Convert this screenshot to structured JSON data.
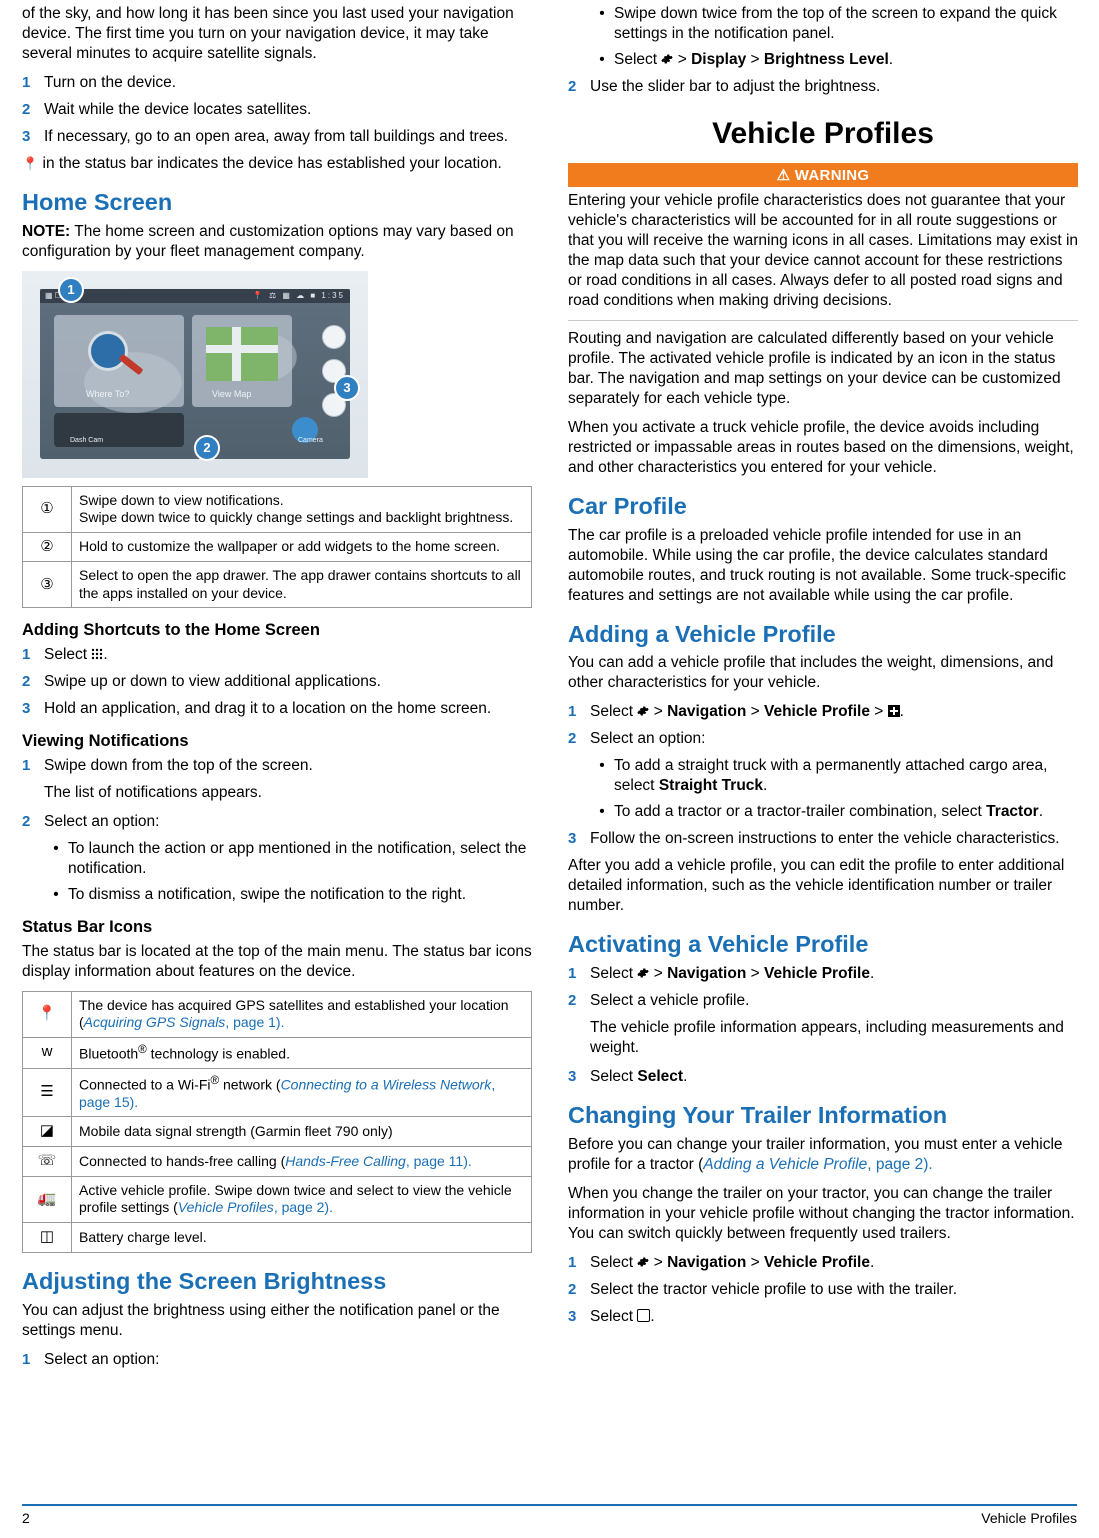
{
  "footer": {
    "page_number": "2",
    "section_title": "Vehicle Profiles"
  },
  "left_column": {
    "intro_paragraph": "of the sky, and how long it has been since you last used your navigation device. The first time you turn on your navigation device, it may take several minutes to acquire satellite signals.",
    "intro_steps": [
      {
        "num": "1",
        "text": "Turn on the device."
      },
      {
        "num": "2",
        "text": "Wait while the device locates satellites."
      },
      {
        "num": "3",
        "text": "If necessary, go to an open area, away from tall buildings and trees."
      }
    ],
    "status_note_icon": "location-pin-icon",
    "status_note": "in the status bar indicates the device has established your location.",
    "home_screen": {
      "heading": "Home Screen",
      "note_label": "NOTE:",
      "note_text": " The home screen and customization options may vary based on configuration by your fleet management company.",
      "device_image": {
        "status_time": "1:35",
        "tile_where_to": "Where To?",
        "tile_view_map": "View Map",
        "tile_dash_cam": "Dash Cam",
        "tile_camera": "Camera",
        "callouts": [
          "1",
          "2",
          "3"
        ]
      },
      "callout_table": [
        {
          "marker": "①",
          "text": "Swipe down to view notifications.\nSwipe down twice to quickly change settings and backlight brightness."
        },
        {
          "marker": "②",
          "text": "Hold to customize the wallpaper or add widgets to the home screen."
        },
        {
          "marker": "③",
          "text": "Select to open the app drawer. The app drawer contains shortcuts to all the apps installed on your device."
        }
      ]
    },
    "adding_shortcuts": {
      "heading": "Adding Shortcuts to the Home Screen",
      "steps": [
        {
          "num": "1",
          "text": "Select",
          "icon": "app-drawer-icon",
          "suffix": "."
        },
        {
          "num": "2",
          "text": "Swipe up or down to view additional applications."
        },
        {
          "num": "3",
          "text": "Hold an application, and drag it to a location on the home screen."
        }
      ]
    },
    "viewing_notifications": {
      "heading": "Viewing Notifications",
      "step1_num": "1",
      "step1_text": "Swipe down from the top of the screen.",
      "step1_result": "The list of notifications appears.",
      "step2_num": "2",
      "step2_text": "Select an option:",
      "bullets": [
        "To launch the action or app mentioned in the notification, select the notification.",
        "To dismiss a notification, swipe the notification to the right."
      ]
    },
    "status_bar_icons": {
      "heading": "Status Bar Icons",
      "intro": "The status bar is located at the top of the main menu. The status bar icons display information about features on the device.",
      "rows": [
        {
          "icon": "gps-pin-icon",
          "text_parts": [
            "The device has acquired GPS satellites and established your location (",
            "Acquiring GPS Signals",
            ", page 1)."
          ]
        },
        {
          "icon": "bluetooth-icon",
          "text_parts": [
            "Bluetooth",
            "®",
            " technology is enabled."
          ]
        },
        {
          "icon": "wifi-icon",
          "text_parts": [
            "Connected to a Wi-Fi",
            "®",
            " network (",
            "Connecting to a Wireless Network",
            ", page 15)."
          ]
        },
        {
          "icon": "cellular-signal-icon",
          "text_parts": [
            "Mobile data signal strength (Garmin fleet 790 only)"
          ]
        },
        {
          "icon": "phone-icon",
          "text_parts": [
            "Connected to hands-free calling (",
            "Hands-Free Calling",
            ", page 11)."
          ]
        },
        {
          "icon": "vehicle-profile-icon",
          "text_parts": [
            "Active vehicle profile. Swipe down twice and select to view the vehicle profile settings (",
            "Vehicle Profiles",
            ", page 2)."
          ]
        },
        {
          "icon": "battery-icon",
          "text_parts": [
            "Battery charge level."
          ]
        }
      ]
    },
    "brightness": {
      "heading": "Adjusting the Screen Brightness",
      "intro": "You can adjust the brightness using either the notification panel or the settings menu.",
      "step1_num": "1",
      "step1_text": "Select an option:"
    }
  },
  "right_column": {
    "brightness_cont": {
      "bullet1": "Swipe down twice from the top of the screen to expand the quick settings in the notification panel.",
      "bullet2_prefix": "Select ",
      "bullet2_icon": "gear-icon",
      "bullet2_mid": " > ",
      "bullet2_display": "Display",
      "bullet2_sep": " > ",
      "bullet2_brightness": "Brightness Level",
      "bullet2_suffix": ".",
      "step2_num": "2",
      "step2_text": "Use the slider bar to adjust the brightness."
    },
    "vehicle_profiles": {
      "title": "Vehicle Profiles",
      "warning_label": "WARNING",
      "warning_icon": "warning-triangle-icon",
      "warning_text": "Entering your vehicle profile characteristics does not guarantee that your vehicle's characteristics will be accounted for in all route suggestions or that you will receive the warning icons in all cases. Limitations may exist in the map data such that your device cannot account for these restrictions or road conditions in all cases. Always defer to all posted road signs and road conditions when making driving decisions.",
      "para1": "Routing and navigation are calculated differently based on your vehicle profile. The activated vehicle profile is indicated by an icon in the status bar. The navigation and map settings on your device can be customized separately for each vehicle type.",
      "para2": "When you activate a truck vehicle profile, the device avoids including restricted or impassable areas in routes based on the dimensions, weight, and other characteristics you entered for your vehicle."
    },
    "car_profile": {
      "heading": "Car Profile",
      "text": "The car profile is a preloaded vehicle profile intended for use in an automobile. While using the car profile, the device calculates standard automobile routes, and truck routing is not available. Some truck-specific features and settings are not available while using the car profile."
    },
    "adding_vehicle_profile": {
      "heading": "Adding a Vehicle Profile",
      "intro": "You can add a vehicle profile that includes the weight, dimensions, and other characteristics for your vehicle.",
      "step1_num": "1",
      "step1_prefix": "Select ",
      "step1_icon": "gear-icon",
      "step1_sep1": " > ",
      "step1_nav": "Navigation",
      "step1_sep2": " > ",
      "step1_profile": "Vehicle Profile",
      "step1_sep3": " > ",
      "step1_plus_icon": "plus-icon",
      "step1_suffix": ".",
      "step2_num": "2",
      "step2_text": "Select an option:",
      "bullets": [
        {
          "pre": "To add a straight truck with a permanently attached cargo area, select ",
          "bold": "Straight Truck",
          "post": "."
        },
        {
          "pre": "To add a tractor or a tractor-trailer combination, select ",
          "bold": "Tractor",
          "post": "."
        }
      ],
      "step3_num": "3",
      "step3_text": "Follow the on-screen instructions to enter the vehicle characteristics.",
      "after_text": "After you add a vehicle profile, you can edit the profile to enter additional detailed information, such as the vehicle identification number or trailer number."
    },
    "activating_vehicle_profile": {
      "heading": "Activating a Vehicle Profile",
      "step1_num": "1",
      "step1_prefix": "Select ",
      "step1_icon": "gear-icon",
      "step1_sep1": " > ",
      "step1_nav": "Navigation",
      "step1_sep2": " > ",
      "step1_profile": "Vehicle Profile",
      "step1_suffix": ".",
      "step2_num": "2",
      "step2_text": "Select a vehicle profile.",
      "step2_result": "The vehicle profile information appears, including measurements and weight.",
      "step3_num": "3",
      "step3_prefix": "Select ",
      "step3_bold": "Select",
      "step3_suffix": "."
    },
    "changing_trailer": {
      "heading": "Changing Your Trailer Information",
      "para1_pre": "Before you can change your trailer information, you must enter a vehicle profile for a tractor (",
      "para1_link": "Adding a Vehicle Profile",
      "para1_post": ", page 2).",
      "para2": "When you change the trailer on your tractor, you can change the trailer information in your vehicle profile without changing the tractor information. You can switch quickly between frequently used trailers.",
      "step1_num": "1",
      "step1_prefix": "Select ",
      "step1_icon": "gear-icon",
      "step1_sep1": " > ",
      "step1_nav": "Navigation",
      "step1_sep2": " > ",
      "step1_profile": "Vehicle Profile",
      "step1_suffix": ".",
      "step2_num": "2",
      "step2_text": "Select the tractor vehicle profile to use with the trailer.",
      "step3_num": "3",
      "step3_prefix": "Select ",
      "step3_icon": "trailer-icon",
      "step3_suffix": "."
    }
  }
}
